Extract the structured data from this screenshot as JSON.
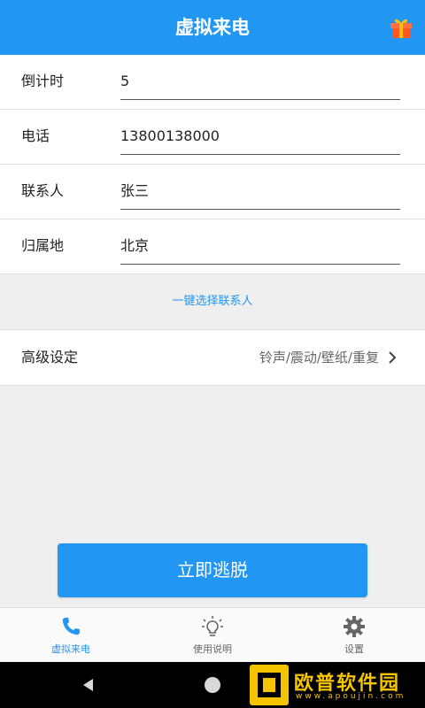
{
  "appbar": {
    "title": "虚拟来电",
    "gift_icon": "gift-icon"
  },
  "form": {
    "rows": [
      {
        "label": "倒计时",
        "value": "5"
      },
      {
        "label": "电话",
        "value": "13800138000"
      },
      {
        "label": "联系人",
        "value": "张三"
      },
      {
        "label": "归属地",
        "value": "北京"
      }
    ]
  },
  "select_contact_label": "一键选择联系人",
  "advanced": {
    "label": "高级设定",
    "options": "铃声/震动/壁纸/重复"
  },
  "escape_button_label": "立即逃脱",
  "tabbar": {
    "tabs": [
      {
        "label": "虚拟来电",
        "icon": "phone-icon",
        "active": true
      },
      {
        "label": "使用说明",
        "icon": "lightbulb-icon",
        "active": false
      },
      {
        "label": "设置",
        "icon": "gear-icon",
        "active": false
      }
    ]
  },
  "watermark": {
    "text": "欧普软件园",
    "url": "www.apoujin.com"
  },
  "colors": {
    "primary": "#2196f3",
    "background": "#efefef",
    "watermark": "#f5c400"
  }
}
